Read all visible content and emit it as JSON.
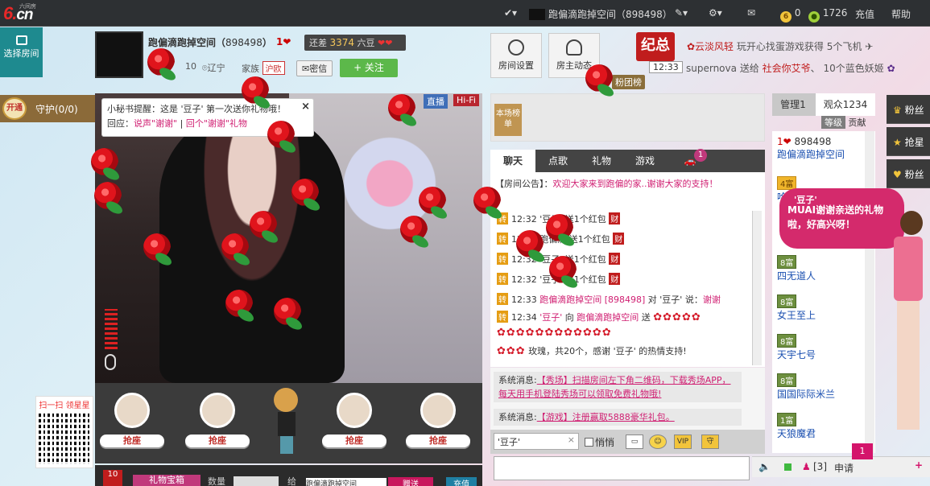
{
  "topbar": {
    "logo_main": "6.",
    "logo_cn": "cn",
    "logo_sub": "六间房",
    "room_title": "跑偏滴跑掉空间（898498）",
    "coins": "0",
    "beans": "1726",
    "recharge": "充值",
    "help": "帮助"
  },
  "left": {
    "select_room": "选择房间",
    "guard_badge": "开通",
    "guard_label": "守护(0/0)",
    "qr_title": "扫一扫 领星星"
  },
  "host": {
    "name": "跑偏滴跑掉空间（",
    "id": "898498",
    "name_tail": "）",
    "level": "1",
    "diff_label": "还差",
    "diff_value": "3374",
    "diff_unit": "六豆",
    "fans": "10",
    "location": "辽宁",
    "family_label": "家族",
    "family_tag": "沪欧",
    "msg_btn": "密信",
    "follow_btn": "+ 关注"
  },
  "video": {
    "badge_live": "直播",
    "badge_hifi": "Hi-Fi",
    "tip_line1": "小秘书提醒：这是 '豆子' 第一次送你礼物哦！",
    "tip_reply": "回应：",
    "tip_link1": "说声\"谢谢\"",
    "tip_sep": " | ",
    "tip_link2": "回个\"谢谢\"礼物"
  },
  "seats": {
    "label": "抢座"
  },
  "bottom": {
    "gift_count": "10",
    "gift_tab": "礼物宝箱",
    "qty_label": "数量",
    "to_label": "给",
    "to_value": "跑偏滴跑掉空间",
    "give": "赠送",
    "recharge": "充值"
  },
  "room": {
    "settings": "房间设置",
    "host_news": "房主动态",
    "jinian": "纪总",
    "ticker1_a": "✿云淡风轻",
    "ticker1_b": "玩开心找蛋游戏获得",
    "ticker1_c": "5个飞机",
    "ticker2_time": "12:33",
    "ticker2_a": "supernova",
    "ticker2_b": "送给",
    "ticker2_c": "社会你艾爷",
    "ticker2_d": "、 10个蓝色妖姬",
    "fan_group": "粉团榜",
    "list_tag": "本场榜单"
  },
  "chat": {
    "tabs": [
      "聊天",
      "点歌",
      "礼物",
      "游戏"
    ],
    "badge": "1",
    "notice_label": "【房间公告】：",
    "notice_text": "欢迎大家来到跑偏的家..谢谢大家的支持！",
    "lines": [
      {
        "tag": "转",
        "text": "12:32 '豆子' 送1个红包",
        "rb": "财"
      },
      {
        "tag": "转",
        "text": "12:32 跑偏滴 送1个红包",
        "rb": "财"
      },
      {
        "tag": "转",
        "text": "12:32 '豆子' 送1个红包",
        "rb": "财"
      },
      {
        "tag": "转",
        "text": "12:32 '豆子' 送1个红包",
        "rb": "财"
      }
    ],
    "talk_time": "12:33",
    "talk_from": "跑偏滴跑掉空间",
    "talk_id": "[898498]",
    "talk_to": "对 '豆子' 说：",
    "talk_msg": "谢谢",
    "gift_time": "12:34",
    "gift_from": "'豆子'",
    "gift_to_lbl": "向",
    "gift_to": "跑偏滴跑掉空间",
    "gift_send": "送",
    "gift_tail": "玫瑰，共20个，感谢 '豆子' 的热情支持!",
    "sys1_label": "系统消息:",
    "sys1_link": "【秀场】扫描房间左下角二维码，下载秀场APP，每天用手机登陆秀场可以领取免费礼物哦!",
    "sys2_label": "系统消息:",
    "sys2_link": "【游戏】注册赢取5888豪华礼包。",
    "input_value": "'豆子'",
    "quiet": "悄悄"
  },
  "audience": {
    "tab_admin": "管理1",
    "tab_viewers": "观众1234",
    "sort": "等级",
    "sort2": "贡献",
    "items": [
      {
        "lv": "1",
        "name": "898498",
        "name2": "跑偏滴跑掉空间"
      },
      {
        "lv": "4富",
        "name": "哈哈"
      },
      {
        "lv": "8富",
        "name": "四无道人"
      },
      {
        "lv": "8富",
        "name": "女王至上"
      },
      {
        "lv": "8富",
        "name": "天宇七号"
      },
      {
        "lv": "8富",
        "name": "国国际际米兰"
      },
      {
        "lv": "1富",
        "name": "天狼魔君"
      }
    ]
  },
  "side": {
    "b1": "粉丝",
    "b2": "抢星",
    "b3": "粉丝"
  },
  "bubble": {
    "title": "'豆子'",
    "text": "MUAI谢谢亲送的礼物啦，好高兴呀！"
  },
  "bottomright": {
    "count": "[3]",
    "apply": "申请",
    "badge": "1"
  }
}
